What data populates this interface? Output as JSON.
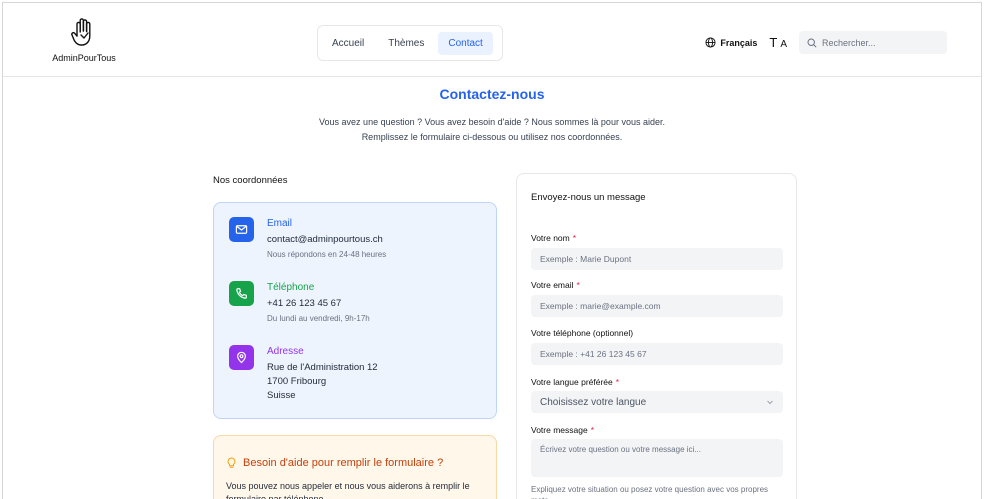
{
  "header": {
    "logo_text": "AdminPourTous",
    "nav": [
      {
        "label": "Accueil"
      },
      {
        "label": "Thèmes"
      },
      {
        "label": "Contact"
      }
    ],
    "language": "Français",
    "text_size_small": "T",
    "text_size_large": "A",
    "search_placeholder": "Rechercher..."
  },
  "hero": {
    "title": "Contactez-nous",
    "subtitle_line1": "Vous avez une question ? Vous avez besoin d'aide ? Nous sommes là pour vous aider.",
    "subtitle_line2": "Remplissez le formulaire ci-dessous ou utilisez nos coordonnées."
  },
  "contact": {
    "section_label": "Nos coordonnées",
    "email": {
      "title": "Email",
      "value": "contact@adminpourtous.ch",
      "note": "Nous répondons en 24-48 heures"
    },
    "phone": {
      "title": "Téléphone",
      "value": "+41 26 123 45 67",
      "note": "Du lundi au vendredi, 9h-17h"
    },
    "address": {
      "title": "Adresse",
      "line1": "Rue de l'Administration 12",
      "line2": "1700 Fribourg",
      "line3": "Suisse"
    }
  },
  "help": {
    "title": "Besoin d'aide pour remplir le formulaire ?",
    "text": "Vous pouvez nous appeler et nous vous aiderons à remplir le formulaire par téléphone."
  },
  "form": {
    "title": "Envoyez-nous un message",
    "required_mark": "*",
    "name": {
      "label": "Votre nom",
      "placeholder": "Exemple : Marie Dupont"
    },
    "email": {
      "label": "Votre email",
      "placeholder": "Exemple : marie@example.com"
    },
    "phone": {
      "label": "Votre téléphone (optionnel)",
      "placeholder": "Exemple : +41 26 123 45 67"
    },
    "language": {
      "label": "Votre langue préférée",
      "value": "Choisissez votre langue"
    },
    "message": {
      "label": "Votre message",
      "placeholder": "Écrivez votre question ou votre message ici...",
      "hint": "Expliquez votre situation ou posez votre question avec vos propres mots."
    }
  },
  "colors": {
    "accent": "#2563eb",
    "email_icon_bg": "#2563eb",
    "phone_icon_bg": "#16a34a",
    "address_icon_bg": "#9333ea",
    "help_title": "#c2410c"
  }
}
